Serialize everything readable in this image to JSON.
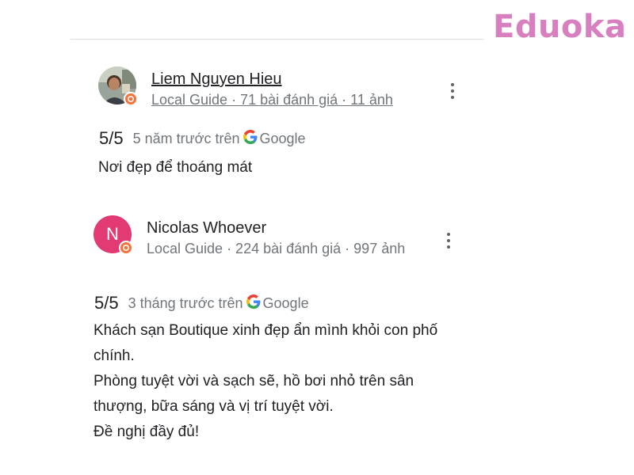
{
  "brand": {
    "logo_text": "Eduoka",
    "color": "#d77fbf"
  },
  "reviews": [
    {
      "reviewer_name": "Liem Nguyen Hieu",
      "reviewer_meta": "Local Guide · 71 bài đánh giá · 11 ảnh",
      "avatar_type": "photo",
      "rating": "5/5",
      "time": "5 năm trước trên",
      "source": "Google",
      "text_lines": [
        "Nơi đẹp để thoáng mát"
      ]
    },
    {
      "reviewer_name": "Nicolas Whoever",
      "reviewer_meta": "Local Guide · 224 bài đánh giá · 997 ảnh",
      "avatar_type": "letter",
      "avatar_letter": "N",
      "avatar_color": "#e23a72",
      "rating": "5/5",
      "time": "3 tháng trước trên",
      "source": "Google",
      "text_lines": [
        "Khách sạn Boutique xinh đẹp ẩn mình khỏi con phố chính.",
        "Phòng tuyệt vời và sạch sẽ, hồ bơi nhỏ trên sân thượng, bữa sáng và vị trí tuyệt vời.",
        "Đề nghị đầy đủ!"
      ]
    }
  ],
  "icons": {
    "more": "more-vert-icon",
    "local_guide_badge": "local-guide-badge-icon",
    "google": "google-g-icon"
  },
  "colors": {
    "badge": "#f4733b",
    "secondary_text": "#70757a",
    "primary_text": "#202124"
  }
}
